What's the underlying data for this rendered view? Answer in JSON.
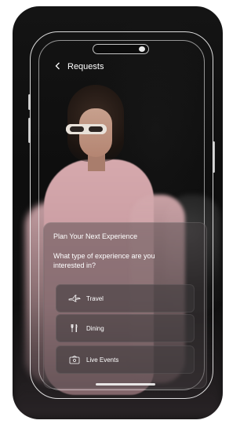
{
  "header": {
    "back_icon": "chevron-left-icon",
    "title": "Requests"
  },
  "plan": {
    "title": "Plan Your Next Experience",
    "question": "What type of experience are you interested in?",
    "options": [
      {
        "label": "Travel",
        "icon": "airplane-icon"
      },
      {
        "label": "Dining",
        "icon": "fork-knife-icon"
      },
      {
        "label": "Live Events",
        "icon": "ticket-icon"
      }
    ]
  },
  "colors": {
    "background": "#ffffff",
    "card": "#121212",
    "text": "#ffffff",
    "panel": "#46404275"
  }
}
